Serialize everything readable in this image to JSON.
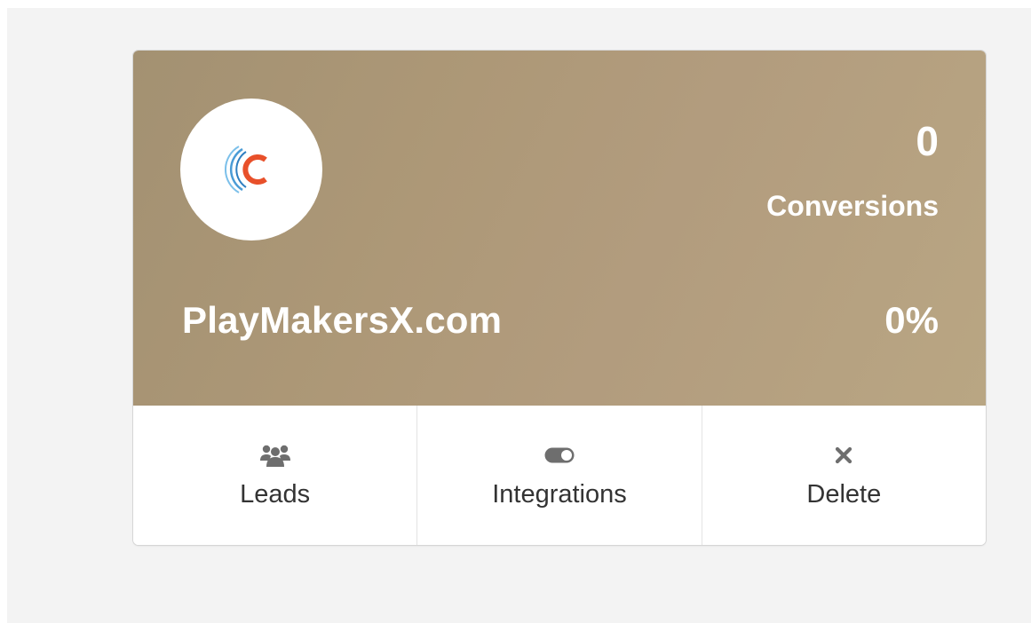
{
  "site": {
    "name": "PlayMakersX.com",
    "logo_icon": "brand-c-logo-icon",
    "logo_colors": {
      "arc_outer": "#5aa6d9",
      "arc_inner": "#2f7fc1",
      "letter": "#e8502a"
    }
  },
  "stats": {
    "conversions_value": "0",
    "conversions_label": "Conversions",
    "conversion_rate": "0%"
  },
  "actions": [
    {
      "label": "Leads",
      "icon": "users-icon"
    },
    {
      "label": "Integrations",
      "icon": "toggle-icon"
    },
    {
      "label": "Delete",
      "icon": "close-icon"
    }
  ],
  "colors": {
    "header_bg": "#ae9878",
    "page_bg": "#f3f3f3",
    "icon_gray": "#6e6e6e",
    "text_dark": "#333333"
  }
}
